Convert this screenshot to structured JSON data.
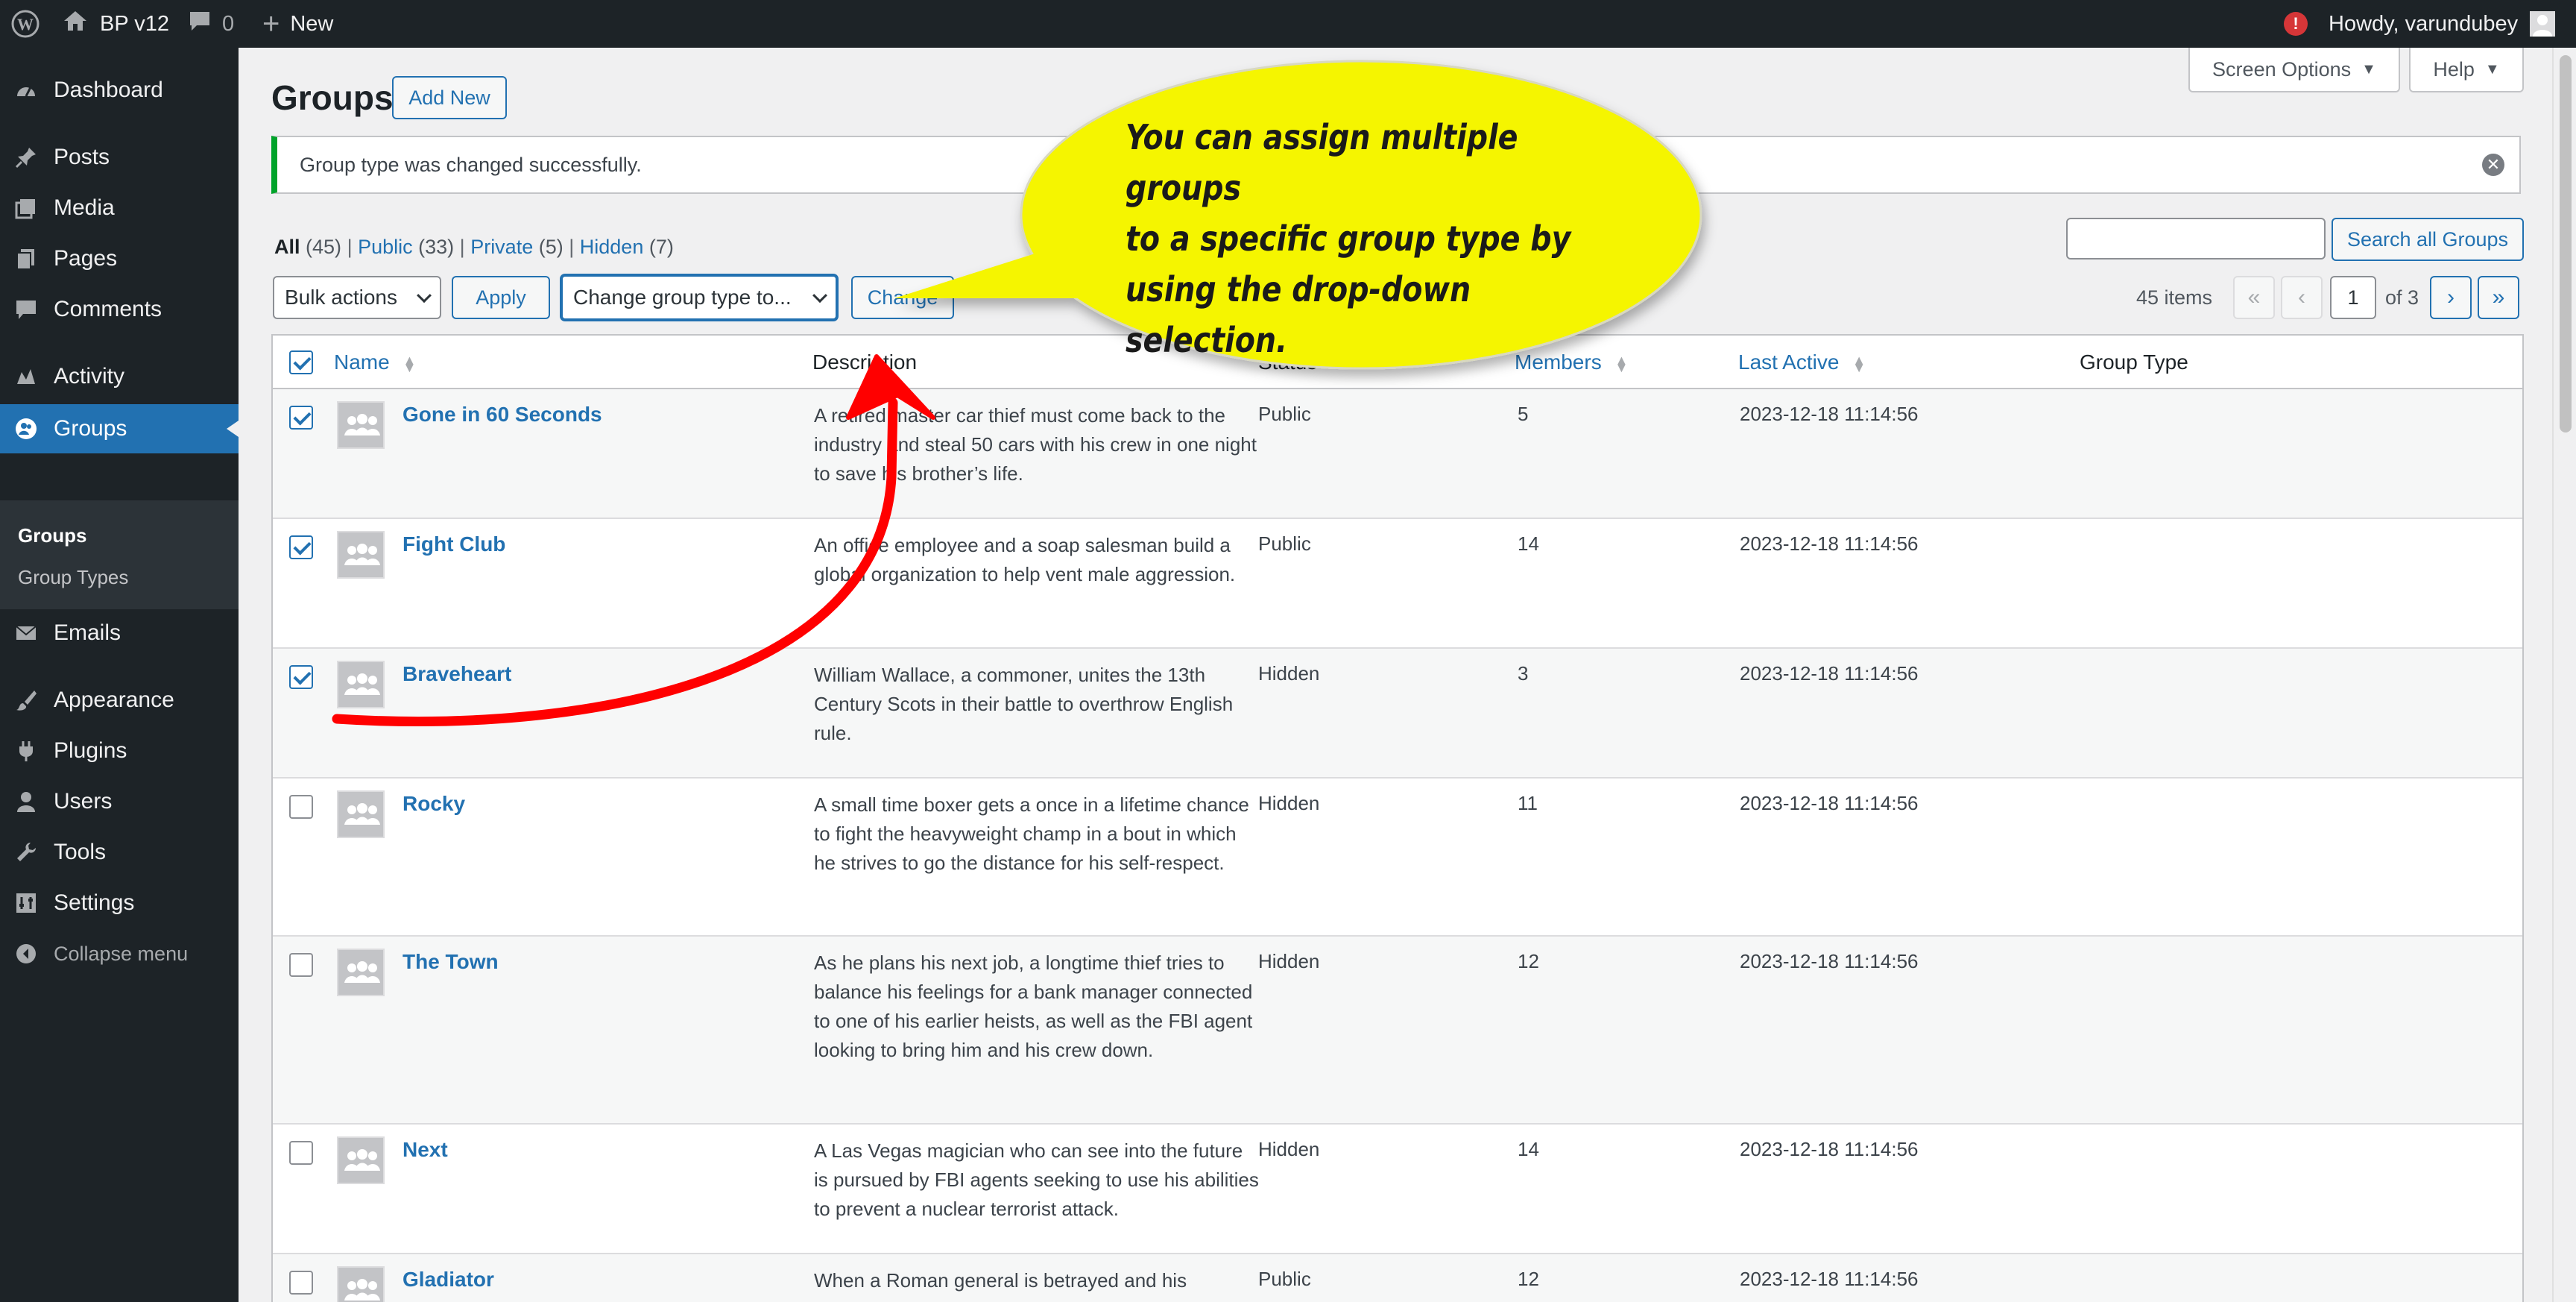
{
  "adminbar": {
    "site_name": "BP v12",
    "comments_count": "0",
    "new_label": "New",
    "howdy": "Howdy, varundubey"
  },
  "sidebar": {
    "items": [
      {
        "label": "Dashboard",
        "icon": "dashboard-icon"
      },
      {
        "label": "Posts",
        "icon": "pin-icon"
      },
      {
        "label": "Media",
        "icon": "media-icon"
      },
      {
        "label": "Pages",
        "icon": "pages-icon"
      },
      {
        "label": "Comments",
        "icon": "comment-icon"
      },
      {
        "label": "Activity",
        "icon": "activity-icon"
      },
      {
        "label": "Groups",
        "icon": "buddypress-icon"
      },
      {
        "label": "Emails",
        "icon": "email-icon"
      },
      {
        "label": "Appearance",
        "icon": "paintbrush-icon"
      },
      {
        "label": "Plugins",
        "icon": "plugin-icon"
      },
      {
        "label": "Users",
        "icon": "user-icon"
      },
      {
        "label": "Tools",
        "icon": "wrench-icon"
      },
      {
        "label": "Settings",
        "icon": "settings-icon"
      },
      {
        "label": "Collapse menu",
        "icon": "collapse-icon"
      }
    ],
    "submenu": [
      "Groups",
      "Group Types"
    ]
  },
  "header": {
    "title": "Groups",
    "add_new": "Add New",
    "screen_options": "Screen Options",
    "help": "Help"
  },
  "notice": {
    "message": "Group type was changed successfully."
  },
  "filters": {
    "all": "All",
    "all_count": "(45)",
    "public": "Public",
    "public_count": "(33)",
    "private": "Private",
    "private_count": "(5)",
    "hidden": "Hidden",
    "hidden_count": "(7)"
  },
  "toolbar": {
    "bulk_actions": "Bulk actions",
    "apply": "Apply",
    "change_group_type": "Change group type to...",
    "change": "Change",
    "search_placeholder": "",
    "search_button": "Search all Groups",
    "items_count": "45 items",
    "current_page": "1",
    "total_pages": "of 3",
    "first": "«",
    "prev": "‹",
    "next": "›",
    "last": "»"
  },
  "table": {
    "columns": {
      "name": "Name",
      "description": "Description",
      "status": "Status",
      "members": "Members",
      "last_active": "Last Active",
      "group_type": "Group Type"
    },
    "rows": [
      {
        "name": "Gone in 60 Seconds",
        "description": "A retired master car thief must come back to the industry and steal 50 cars with his crew in one night to save his brother’s life.",
        "status": "Public",
        "members": "5",
        "last_active": "2023-12-18 11:14:56",
        "group_type": ""
      },
      {
        "name": "Fight Club",
        "description": "An office employee and a soap salesman build a global organization to help vent male aggression.",
        "status": "Public",
        "members": "14",
        "last_active": "2023-12-18 11:14:56",
        "group_type": ""
      },
      {
        "name": "Braveheart",
        "description": "William Wallace, a commoner, unites the 13th Century Scots in their battle to overthrow English rule.",
        "status": "Hidden",
        "members": "3",
        "last_active": "2023-12-18 11:14:56",
        "group_type": ""
      },
      {
        "name": "Rocky",
        "description": "A small time boxer gets a once in a lifetime chance to fight the heavyweight champ in a bout in which he strives to go the distance for his self-respect.",
        "status": "Hidden",
        "members": "11",
        "last_active": "2023-12-18 11:14:56",
        "group_type": ""
      },
      {
        "name": "The Town",
        "description": "As he plans his next job, a longtime thief tries to balance his feelings for a bank manager connected to one of his earlier heists, as well as the FBI agent looking to bring him and his crew down.",
        "status": "Hidden",
        "members": "12",
        "last_active": "2023-12-18 11:14:56",
        "group_type": ""
      },
      {
        "name": "Next",
        "description": "A Las Vegas magician who can see into the future is pursued by FBI agents seeking to use his abilities to prevent a nuclear terrorist attack.",
        "status": "Hidden",
        "members": "14",
        "last_active": "2023-12-18 11:14:56",
        "group_type": ""
      },
      {
        "name": "Gladiator",
        "description": "When a Roman general is betrayed and his",
        "status": "Public",
        "members": "12",
        "last_active": "2023-12-18 11:14:56",
        "group_type": ""
      }
    ]
  },
  "callout": {
    "text_lines": [
      "You can assign multiple groups",
      "to a specific group type by",
      "using the drop-down selection."
    ],
    "bubble_color": "#f5f500",
    "arrow_color": "#ff0000"
  }
}
